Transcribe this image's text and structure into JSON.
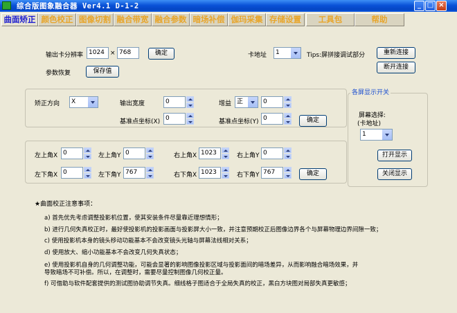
{
  "window": {
    "title": "综合版图象融合器  Ver4.1   D-1-2",
    "min_label": "_",
    "max_label": "□",
    "close_label": "×"
  },
  "tabs": [
    {
      "label": "曲面矫正",
      "active": true
    },
    {
      "label": "颜色校正",
      "active": false
    },
    {
      "label": "图像切割",
      "active": false
    },
    {
      "label": "融合带宽",
      "active": false
    },
    {
      "label": "融合参数",
      "active": false
    },
    {
      "label": "暗场补偿",
      "active": false
    },
    {
      "label": "伽玛采集",
      "active": false
    },
    {
      "label": "存储设置",
      "active": false
    },
    {
      "label": "工具包",
      "active": false
    },
    {
      "label": "帮助",
      "active": false
    }
  ],
  "resolution": {
    "label": "输出卡分辨率",
    "width": "1024",
    "times": "×",
    "height": "768",
    "confirm": "确定"
  },
  "params": {
    "label": "参数恢复",
    "save": "保存值"
  },
  "card": {
    "label": "卡地址",
    "value": "1",
    "tips": "Tips:屏拼接调试部分",
    "reconnect": "重新连接",
    "disconnect": "断开连接"
  },
  "correction": {
    "direction_label": "矫正方向",
    "direction_value": "X",
    "width_label": "输出宽度",
    "width_value": "0",
    "gain_label": "增益",
    "gain_sign": "正",
    "gain_value": "0",
    "base_x_label": "基准点坐标(X)",
    "base_x_value": "0",
    "base_y_label": "基准点坐标(Y)",
    "base_y_value": "0",
    "confirm": "确定"
  },
  "corners": {
    "lt_x_label": "左上角X",
    "lt_x": "0",
    "lt_y_label": "左上角Y",
    "lt_y": "0",
    "rt_x_label": "右上角X",
    "rt_x": "1023",
    "rt_y_label": "右上角Y",
    "rt_y": "0",
    "lb_x_label": "左下角X",
    "lb_x": "0",
    "lb_y_label": "左下角Y",
    "lb_y": "767",
    "rb_x_label": "右下角X",
    "rb_x": "1023",
    "rb_y_label": "右下角Y",
    "rb_y": "767",
    "confirm": "确定"
  },
  "screen_panel": {
    "title": "各屏显示开关",
    "select_label_1": "屏幕选择:",
    "select_label_2": "(卡地址)",
    "select_value": "1",
    "open": "打开显示",
    "close": "关闭显示"
  },
  "notes": {
    "heading": "★曲面校正注意事项：",
    "lines": [
      "a)  首先优先考虑调整投影机位置，使其安装条件尽量靠近理想情形；",
      "b)  进行几何失真校正时，最好使投影机的投影画面与投影屏大小一致，并注意预期校正后图像边界各个与屏幕物理边界间隙一致；",
      "c)  使用投影机本身的镜头移动功能基本不会改变镜头光轴与屏幕法线相对关系；",
      "d)  使用放大、缩小功能基本不会改变几何失真状态；",
      "e)  使用投影机自身的几何调整功能，可能会显著的影响图像投影区域与投影面间的暗场差异，从而影响融合暗场效果，并",
      "    导致暗场不可补偿。所以，在调整时，需要尽量控制图像几何校正量。",
      "f)  可借助与软件配套提供的测试图协助调节失真。细线格子图适合于全局失真的校正，黑白方块图对局部失真更敏感；"
    ]
  }
}
